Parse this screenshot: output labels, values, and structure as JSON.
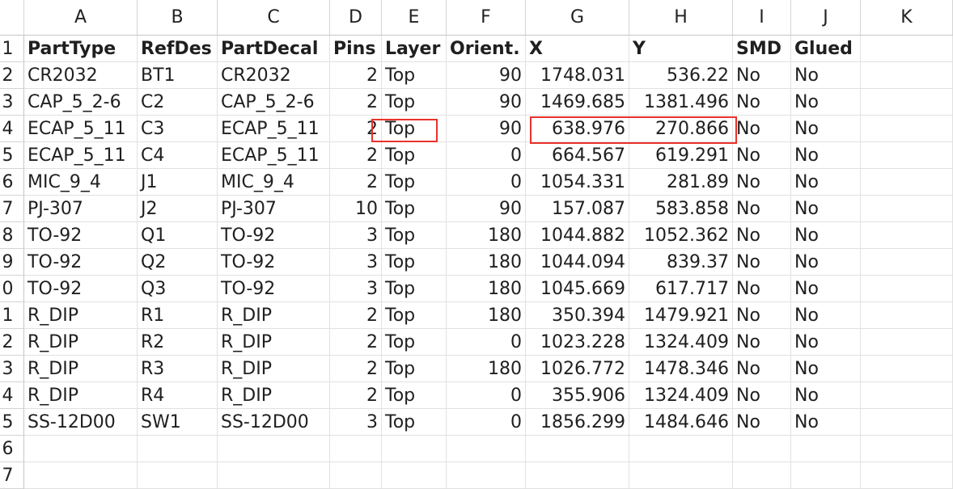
{
  "columns": [
    "A",
    "B",
    "C",
    "D",
    "E",
    "F",
    "G",
    "H",
    "I",
    "J",
    "K"
  ],
  "row_numbers": [
    "1",
    "2",
    "3",
    "4",
    "5",
    "6",
    "7",
    "8",
    "9",
    "0",
    "1",
    "2",
    "3",
    "4",
    "5",
    "6",
    "7"
  ],
  "headers": [
    "PartType",
    "RefDes",
    "PartDecal",
    "Pins",
    "Layer",
    "Orient.",
    "X",
    "Y",
    "SMD",
    "Glued"
  ],
  "rows": [
    [
      "CR2032",
      "BT1",
      "CR2032",
      "2",
      "Top",
      "90",
      "1748.031",
      "536.22",
      "No",
      "No"
    ],
    [
      "CAP_5_2-6",
      "C2",
      "CAP_5_2-6",
      "2",
      "Top",
      "90",
      "1469.685",
      "1381.496",
      "No",
      "No"
    ],
    [
      "ECAP_5_11",
      "C3",
      "ECAP_5_11",
      "2",
      "Top",
      "90",
      "638.976",
      "270.866",
      "No",
      "No"
    ],
    [
      "ECAP_5_11",
      "C4",
      "ECAP_5_11",
      "2",
      "Top",
      "0",
      "664.567",
      "619.291",
      "No",
      "No"
    ],
    [
      "MIC_9_4",
      "J1",
      "MIC_9_4",
      "2",
      "Top",
      "0",
      "1054.331",
      "281.89",
      "No",
      "No"
    ],
    [
      "PJ-307",
      "J2",
      "PJ-307",
      "10",
      "Top",
      "90",
      "157.087",
      "583.858",
      "No",
      "No"
    ],
    [
      "TO-92",
      "Q1",
      "TO-92",
      "3",
      "Top",
      "180",
      "1044.882",
      "1052.362",
      "No",
      "No"
    ],
    [
      "TO-92",
      "Q2",
      "TO-92",
      "3",
      "Top",
      "180",
      "1044.094",
      "839.37",
      "No",
      "No"
    ],
    [
      "TO-92",
      "Q3",
      "TO-92",
      "3",
      "Top",
      "180",
      "1045.669",
      "617.717",
      "No",
      "No"
    ],
    [
      "R_DIP",
      "R1",
      "R_DIP",
      "2",
      "Top",
      "180",
      "350.394",
      "1479.921",
      "No",
      "No"
    ],
    [
      "R_DIP",
      "R2",
      "R_DIP",
      "2",
      "Top",
      "0",
      "1023.228",
      "1324.409",
      "No",
      "No"
    ],
    [
      "R_DIP",
      "R3",
      "R_DIP",
      "2",
      "Top",
      "180",
      "1026.772",
      "1478.346",
      "No",
      "No"
    ],
    [
      "R_DIP",
      "R4",
      "R_DIP",
      "2",
      "Top",
      "0",
      "355.906",
      "1324.409",
      "No",
      "No"
    ],
    [
      "SS-12D00",
      "SW1",
      "SS-12D00",
      "3",
      "Top",
      "0",
      "1856.299",
      "1484.646",
      "No",
      "No"
    ]
  ],
  "numeric_columns": [
    3,
    5,
    6,
    7
  ],
  "highlight_color": "#e8322b"
}
